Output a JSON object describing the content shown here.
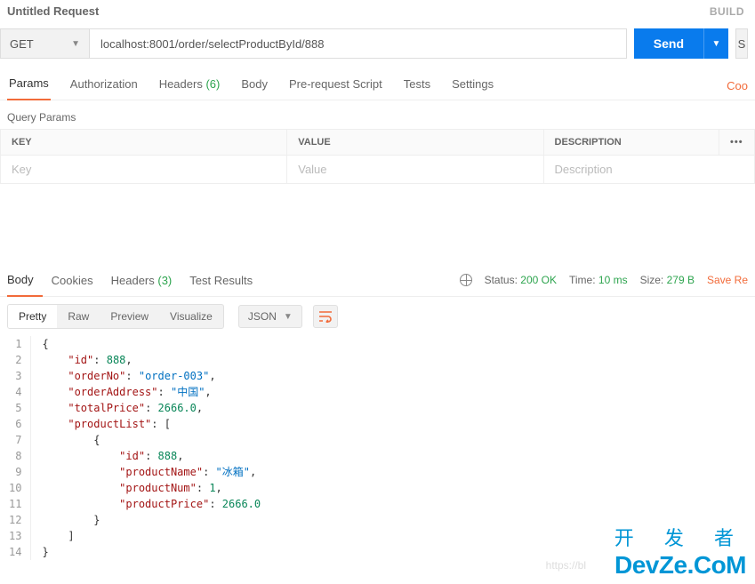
{
  "header": {
    "title": "Untitled Request",
    "build": "BUILD"
  },
  "request": {
    "method": "GET",
    "url": "localhost:8001/order/selectProductById/888",
    "send_label": "Send",
    "save_stub": "S"
  },
  "tabs": {
    "items": [
      {
        "label": "Params",
        "active": true
      },
      {
        "label": "Authorization"
      },
      {
        "label": "Headers",
        "count": "(6)"
      },
      {
        "label": "Body"
      },
      {
        "label": "Pre-request Script"
      },
      {
        "label": "Tests"
      },
      {
        "label": "Settings"
      }
    ],
    "cookies_cut": "Coo"
  },
  "params": {
    "section_title": "Query Params",
    "headers": {
      "key": "KEY",
      "value": "VALUE",
      "desc": "DESCRIPTION"
    },
    "placeholders": {
      "key": "Key",
      "value": "Value",
      "desc": "Description"
    }
  },
  "response": {
    "tabs": [
      {
        "label": "Body",
        "active": true
      },
      {
        "label": "Cookies"
      },
      {
        "label": "Headers",
        "count": "(3)"
      },
      {
        "label": "Test Results"
      }
    ],
    "status_label": "Status:",
    "status_value": "200 OK",
    "time_label": "Time:",
    "time_value": "10 ms",
    "size_label": "Size:",
    "size_value": "279 B",
    "save": "Save Re"
  },
  "viewer": {
    "modes": [
      "Pretty",
      "Raw",
      "Preview",
      "Visualize"
    ],
    "format": "JSON"
  },
  "body_json": {
    "id": 888,
    "orderNo": "order-003",
    "orderAddress": "中国",
    "totalPrice": 2666.0,
    "productList": [
      {
        "id": 888,
        "productName": "冰箱",
        "productNum": 1,
        "productPrice": 2666.0
      }
    ]
  },
  "watermark": {
    "cn": "开 发 者",
    "en": "DevZe.CoM",
    "url": "https://bl"
  }
}
